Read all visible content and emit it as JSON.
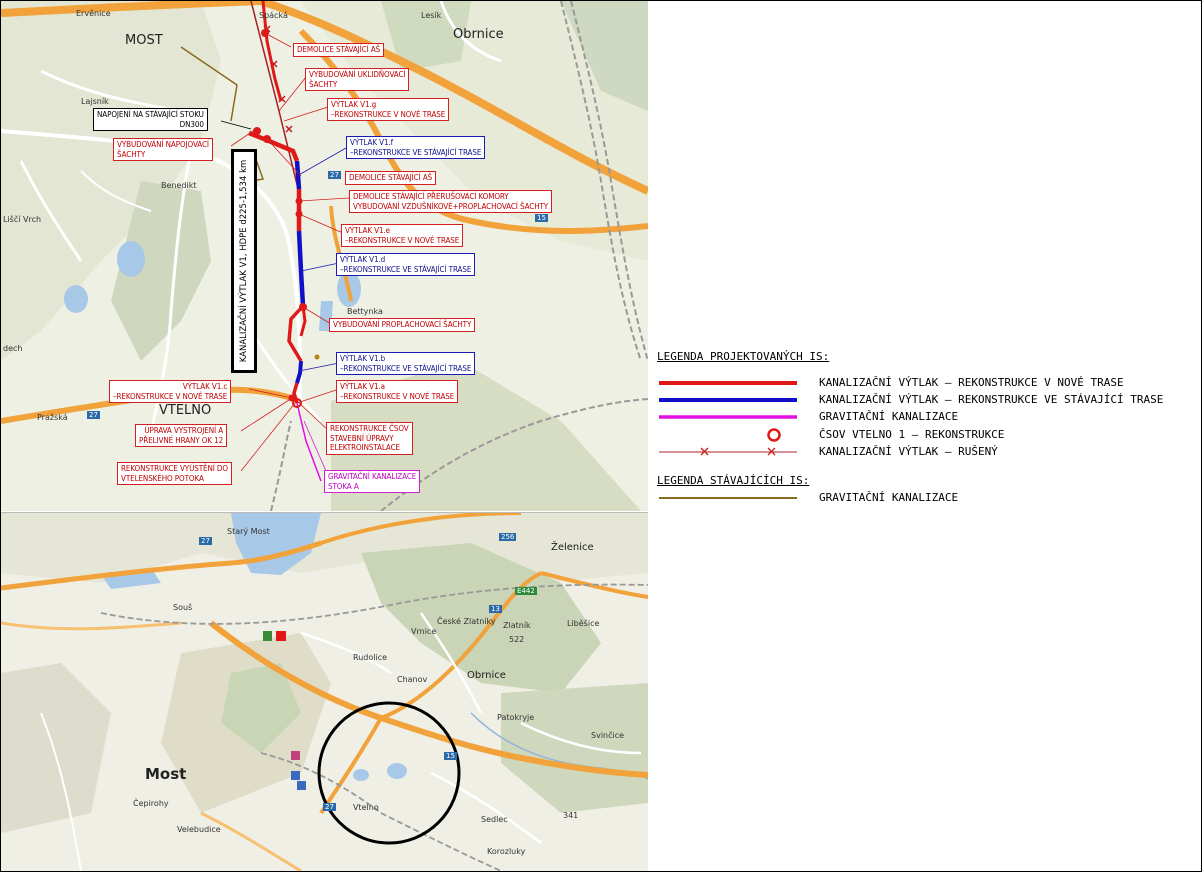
{
  "map_top": {
    "places": {
      "most": "MOST",
      "obrnice": "Obrnice",
      "vtelno": "VTELNO",
      "lajsnik": "Lajsník",
      "benedikt": "Benedikt",
      "lisci_vrch": "Liščí Vrch",
      "ervenice": "Ervěnice",
      "bettynka": "Bettynka",
      "lesik": "Lesík",
      "spack": "Spácká",
      "prazska": "Pražská",
      "dech": "dech"
    },
    "road_badges": [
      "27",
      "15",
      "27"
    ],
    "vertical_label": "KANALIZAČNÍ VÝTLAK V1, HDPE d225-1,534 km",
    "callouts": {
      "demolice_as_top": "DEMOLICE STÁVAJÍCÍ AŠ",
      "vybudovani_uklidnovaci": "VYBUDOVÁNÍ UKLIDŇOVACÍ\nŠACHTY",
      "vytlak_v1g": "VÝTLAK V1.g\n–REKONSTRUKCE V NOVÉ TRASE",
      "napojeni": "NAPOJENÍ NA STÁVAJÍCÍ STOKU\nDN300",
      "vybudovani_napojovaci": "VYBUDOVÁNÍ NAPOJOVACÍ\nŠACHTY",
      "vytlak_v1f": "VÝTLAK V1.f\n–REKONSTRUKCE VE STÁVAJÍCÍ TRASE",
      "demolice_as_mid": "DEMOLICE STÁVAJÍCÍ AŠ",
      "demolice_komory": "DEMOLICE STÁVAJÍCÍ PŘERUŠOVACÍ KOMORY\nVYBUDOVÁNÍ VZDUŠNÍKOVÉ+PROPLACHOVACÍ ŠACHTY",
      "vytlak_v1e": "VÝTLAK V1.e\n–REKONSTRUKCE V NOVÉ TRASE",
      "vytlak_v1d": "VÝTLAK V1.d\n–REKONSTRUKCE VE STÁVAJÍCÍ TRASE",
      "vybudovani_proplachovaci": "VYBUDOVÁNÍ PROPLACHOVACÍ ŠACHTY",
      "vytlak_v1b": "VÝTLAK V1.b\n–REKONSTRUKCE VE STÁVAJÍCÍ TRASE",
      "vytlak_v1c": "VÝTLAK V1.c\n–REKONSTRUKCE V NOVÉ TRASE",
      "vytlak_v1a": "VÝTLAK V1.a\n–REKONSTRUKCE V NOVÉ TRASE",
      "uprava_vystrojeni": "ÚPRAVA VYSTROJENÍ A\nPŘELIVNÉ HRANY OK 12",
      "rekonstrukce_csov": "REKONSTRUKCE ČSOV\nSTAVEBNÍ ÚPRAVY\nELEKTROINSTALACE",
      "rekonstrukce_vyusteni": "REKONSTRUKCE VYÚSTĚNÍ DO\nVTELENSKÉHO POTOKA",
      "gravitacni_stoka_a": "GRAVITAČNÍ KANALIZACE\nSTOKA A"
    }
  },
  "map_bottom": {
    "places": {
      "most": "Most",
      "obrnice": "Obrnice",
      "zelenice": "Želenice",
      "rudolice": "Rudolice",
      "chanov": "Chanov",
      "patokryje": "Patokryje",
      "vtelno": "Vtelno",
      "velebudice": "Velebudice",
      "ceprofry": "Čepirohy",
      "sous": "Souš",
      "ceske_zlatniky": "České Zlatníky",
      "libesice": "Liběšice",
      "zlatnik": "Zlatník",
      "vrnice": "Vrnice",
      "svinčice": "Svinčice",
      "sedlec": "Sedlec",
      "korozluky": "Korozluky",
      "stary_most": "Starý Most",
      "hill_522": "522",
      "hill_341": "341"
    },
    "road_badges": [
      "27",
      "256",
      "13",
      "E442",
      "15",
      "27"
    ]
  },
  "legend": {
    "heading_projected": "LEGENDA PROJEKTOVANÝCH IS:",
    "heading_existing": "LEGENDA STÁVAJÍCÍCH IS:",
    "items": [
      {
        "label": "KANALIZAČNÍ VÝTLAK – REKONSTRUKCE V NOVÉ TRASE",
        "color": "#e01818",
        "symbol": "line"
      },
      {
        "label": "KANALIZAČNÍ VÝTLAK – REKONSTRUKCE VE STÁVAJÍCÍ TRASE",
        "color": "#1010c8",
        "symbol": "line"
      },
      {
        "label": "GRAVITAČNÍ KANALIZACE",
        "color": "#e010e0",
        "symbol": "line"
      },
      {
        "label": "ČSOV VTELNO 1 – REKONSTRUKCE",
        "color": "#e01818",
        "symbol": "circle"
      },
      {
        "label": "KANALIZAČNÍ VÝTLAK – RUŠENÝ",
        "color": "#b02020",
        "symbol": "crossed-line"
      }
    ],
    "existing_items": [
      {
        "label": "GRAVITAČNÍ KANALIZACE",
        "color": "#8a6a20",
        "symbol": "line"
      }
    ]
  }
}
